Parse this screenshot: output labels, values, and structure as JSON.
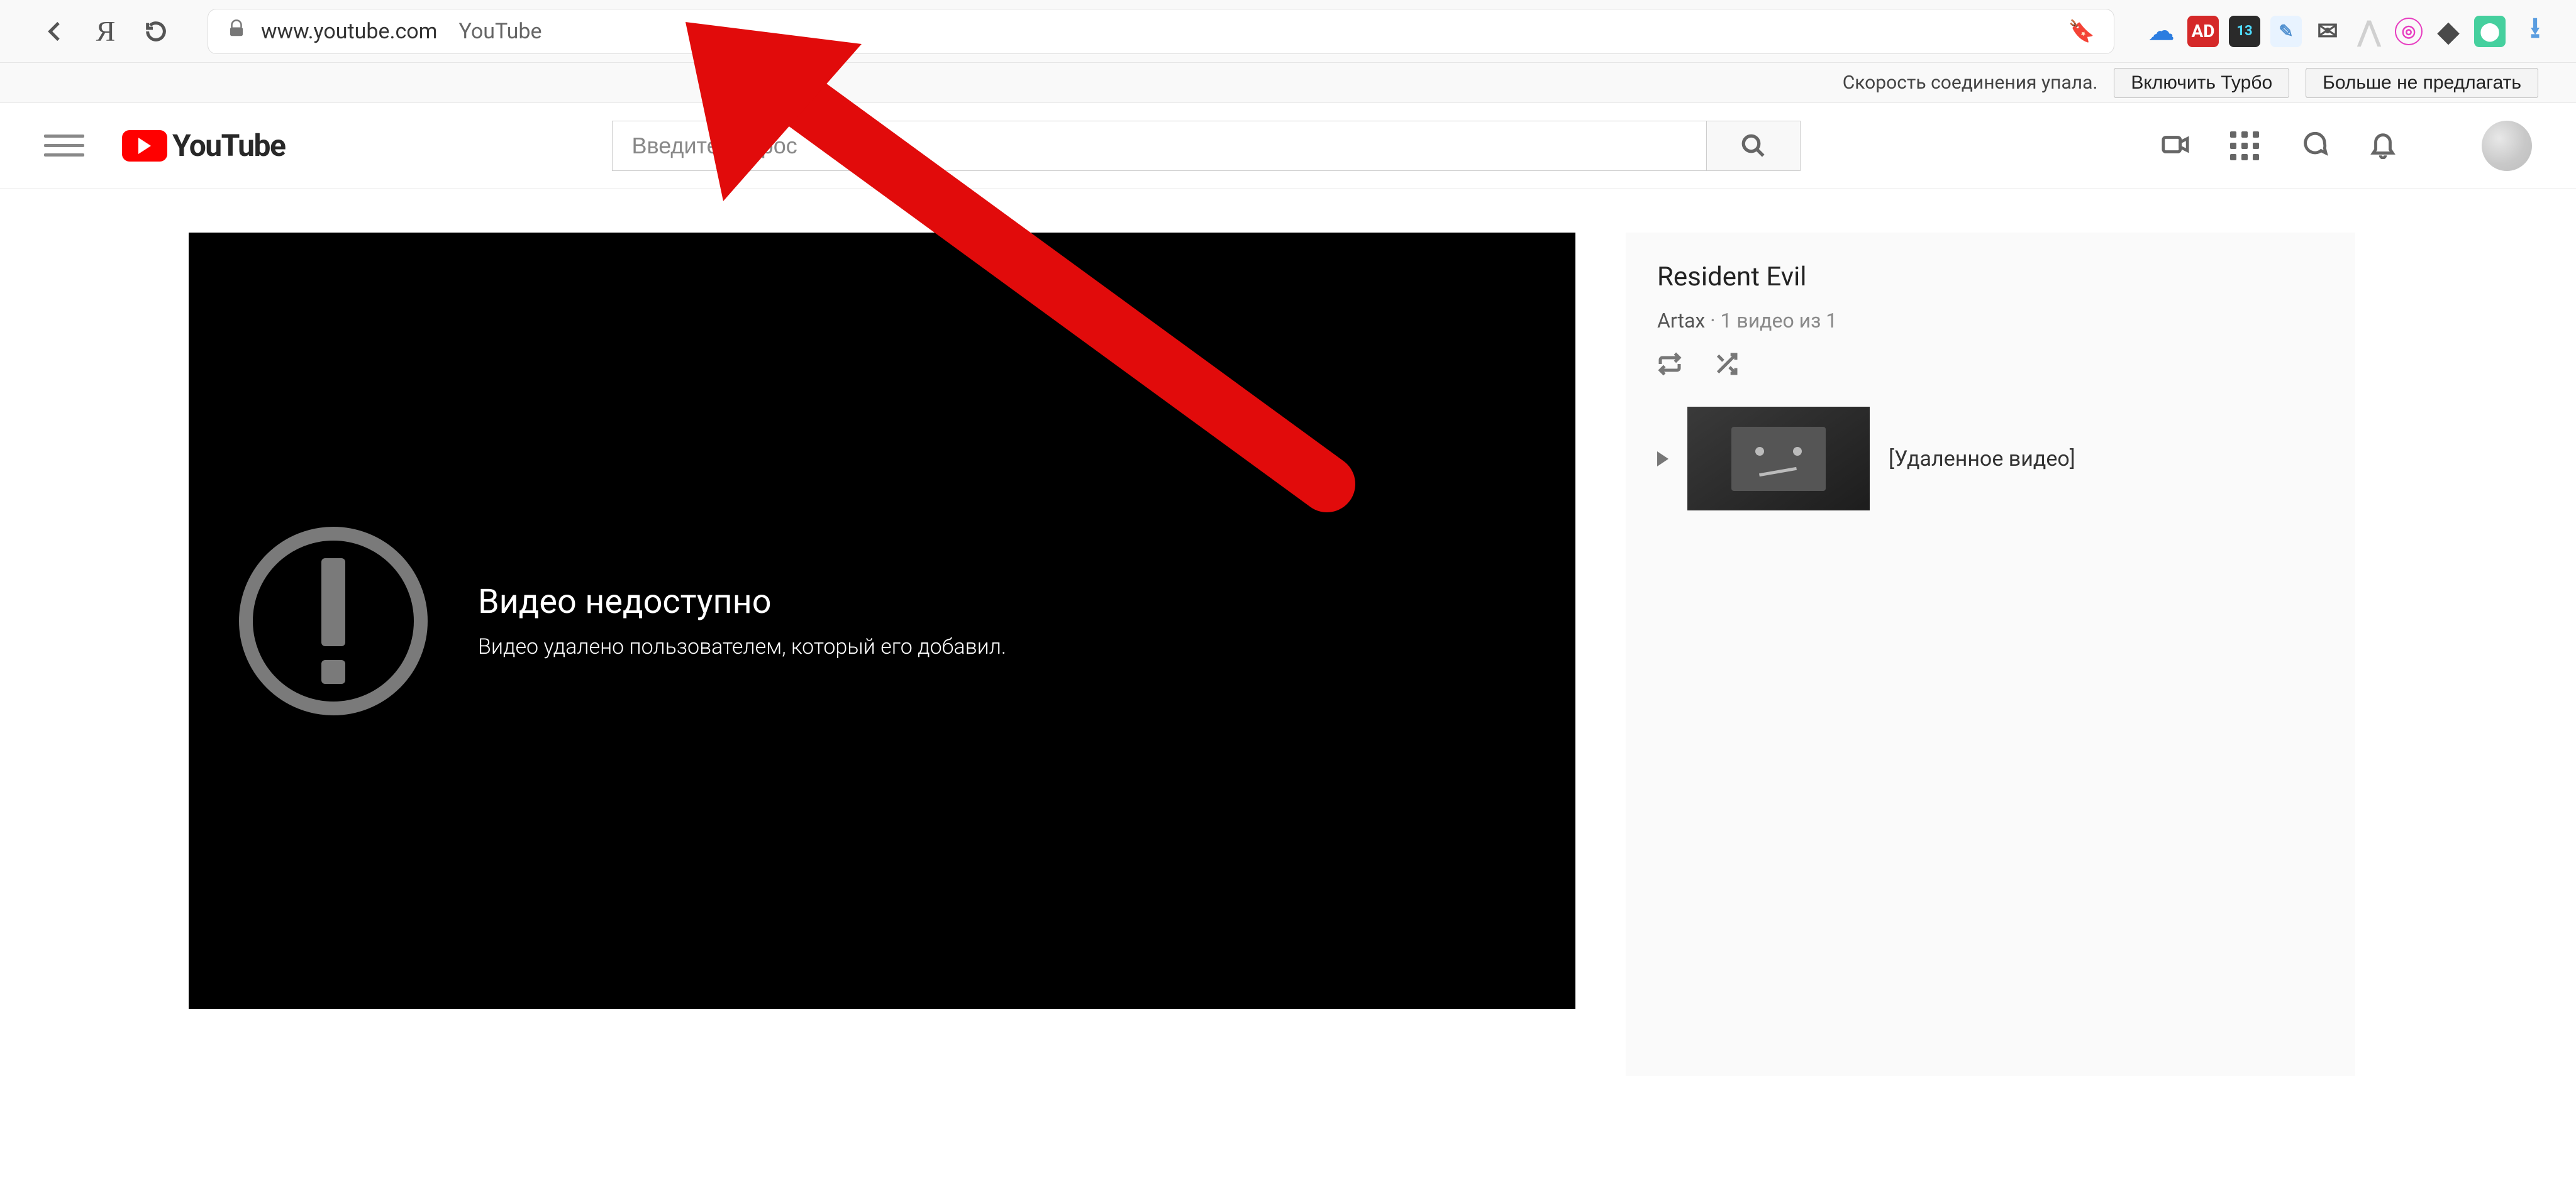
{
  "browser": {
    "url": "www.youtube.com",
    "page_title": "YouTube",
    "extension_badge": "13"
  },
  "speedbar": {
    "message": "Скорость соединения упала.",
    "turbo_btn": "Включить Турбо",
    "dismiss_btn": "Больше не предлагать"
  },
  "masthead": {
    "logo_text": "YouTube",
    "search_placeholder": "Введите запрос"
  },
  "player": {
    "error_title": "Видео недоступно",
    "error_sub": "Видео удалено пользователем, который его добавил."
  },
  "playlist": {
    "title": "Resident Evil",
    "author": "Artax",
    "count_text": "1 видео из 1",
    "item_title": "[Удаленное видео]"
  }
}
